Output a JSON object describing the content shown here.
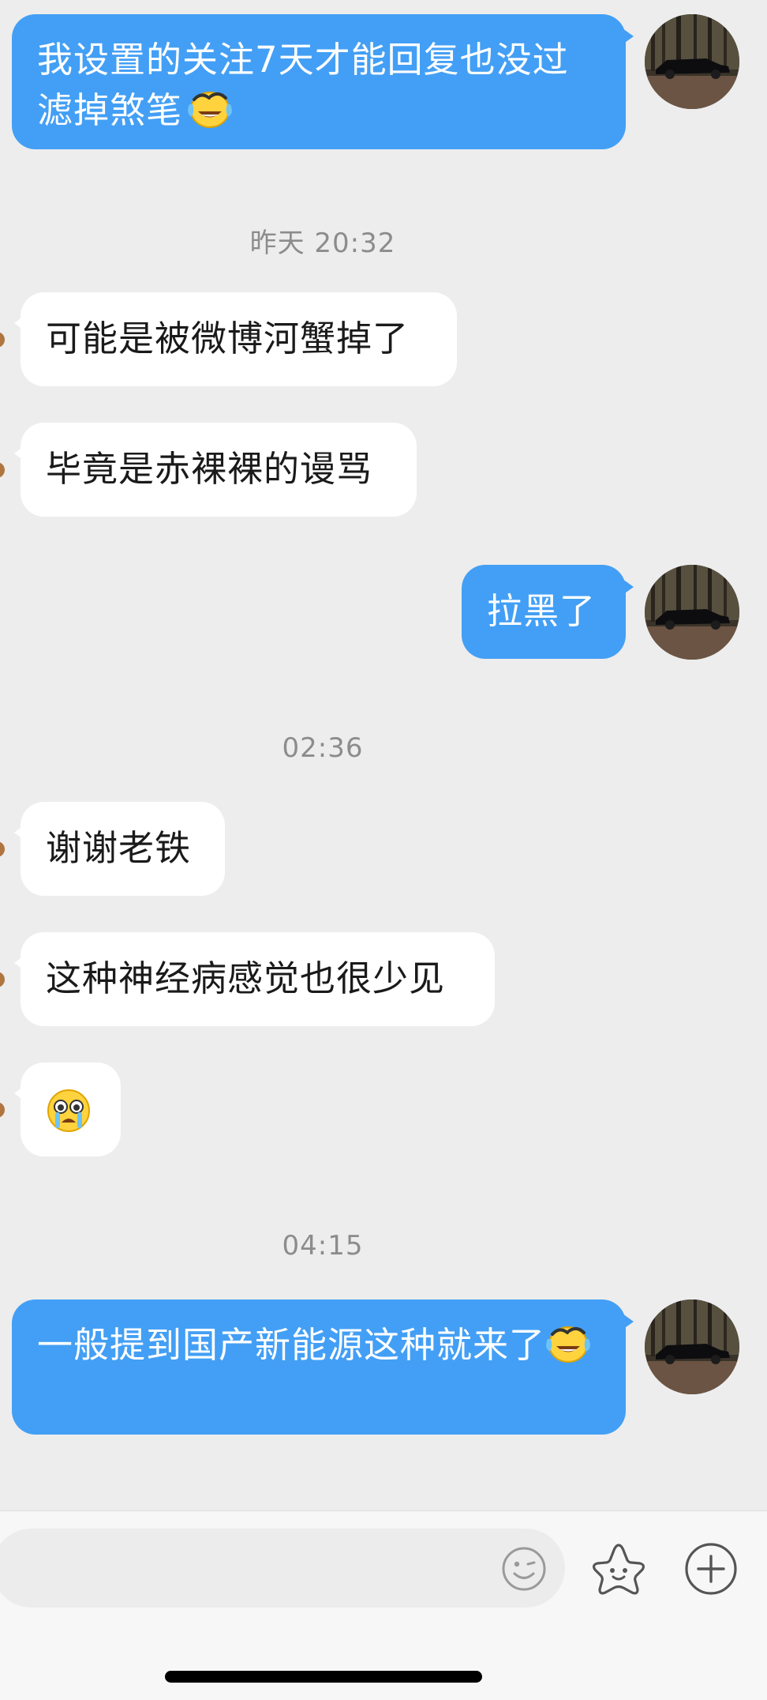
{
  "conversation": {
    "messages": [
      {
        "side": "out",
        "text": "我设置的关注7天才能回复也没过滤掉煞笔",
        "emoji": "laughing-crying-face"
      },
      {
        "timestamp": "昨天 20:32"
      },
      {
        "side": "in",
        "text": "可能是被微博河蟹掉了"
      },
      {
        "side": "in",
        "text": "毕竟是赤裸裸的谩骂"
      },
      {
        "side": "out",
        "text": "拉黑了"
      },
      {
        "timestamp": "02:36"
      },
      {
        "side": "in",
        "text": "谢谢老铁"
      },
      {
        "side": "in",
        "text": "这种神经病感觉也很少见"
      },
      {
        "side": "in",
        "emoji": "crying-face"
      },
      {
        "timestamp": "04:15"
      },
      {
        "side": "out",
        "text": "一般提到国产新能源这种就来了",
        "emoji": "laughing-crying-face"
      }
    ]
  },
  "input_bar": {
    "placeholder": "",
    "icons": [
      "smiley-icon",
      "sticker-star-icon",
      "plus-icon"
    ]
  },
  "colors": {
    "background": "#ededed",
    "outgoing_bubble": "#439ff5",
    "incoming_bubble": "#ffffff",
    "timestamp_text": "#8c8c8c"
  }
}
